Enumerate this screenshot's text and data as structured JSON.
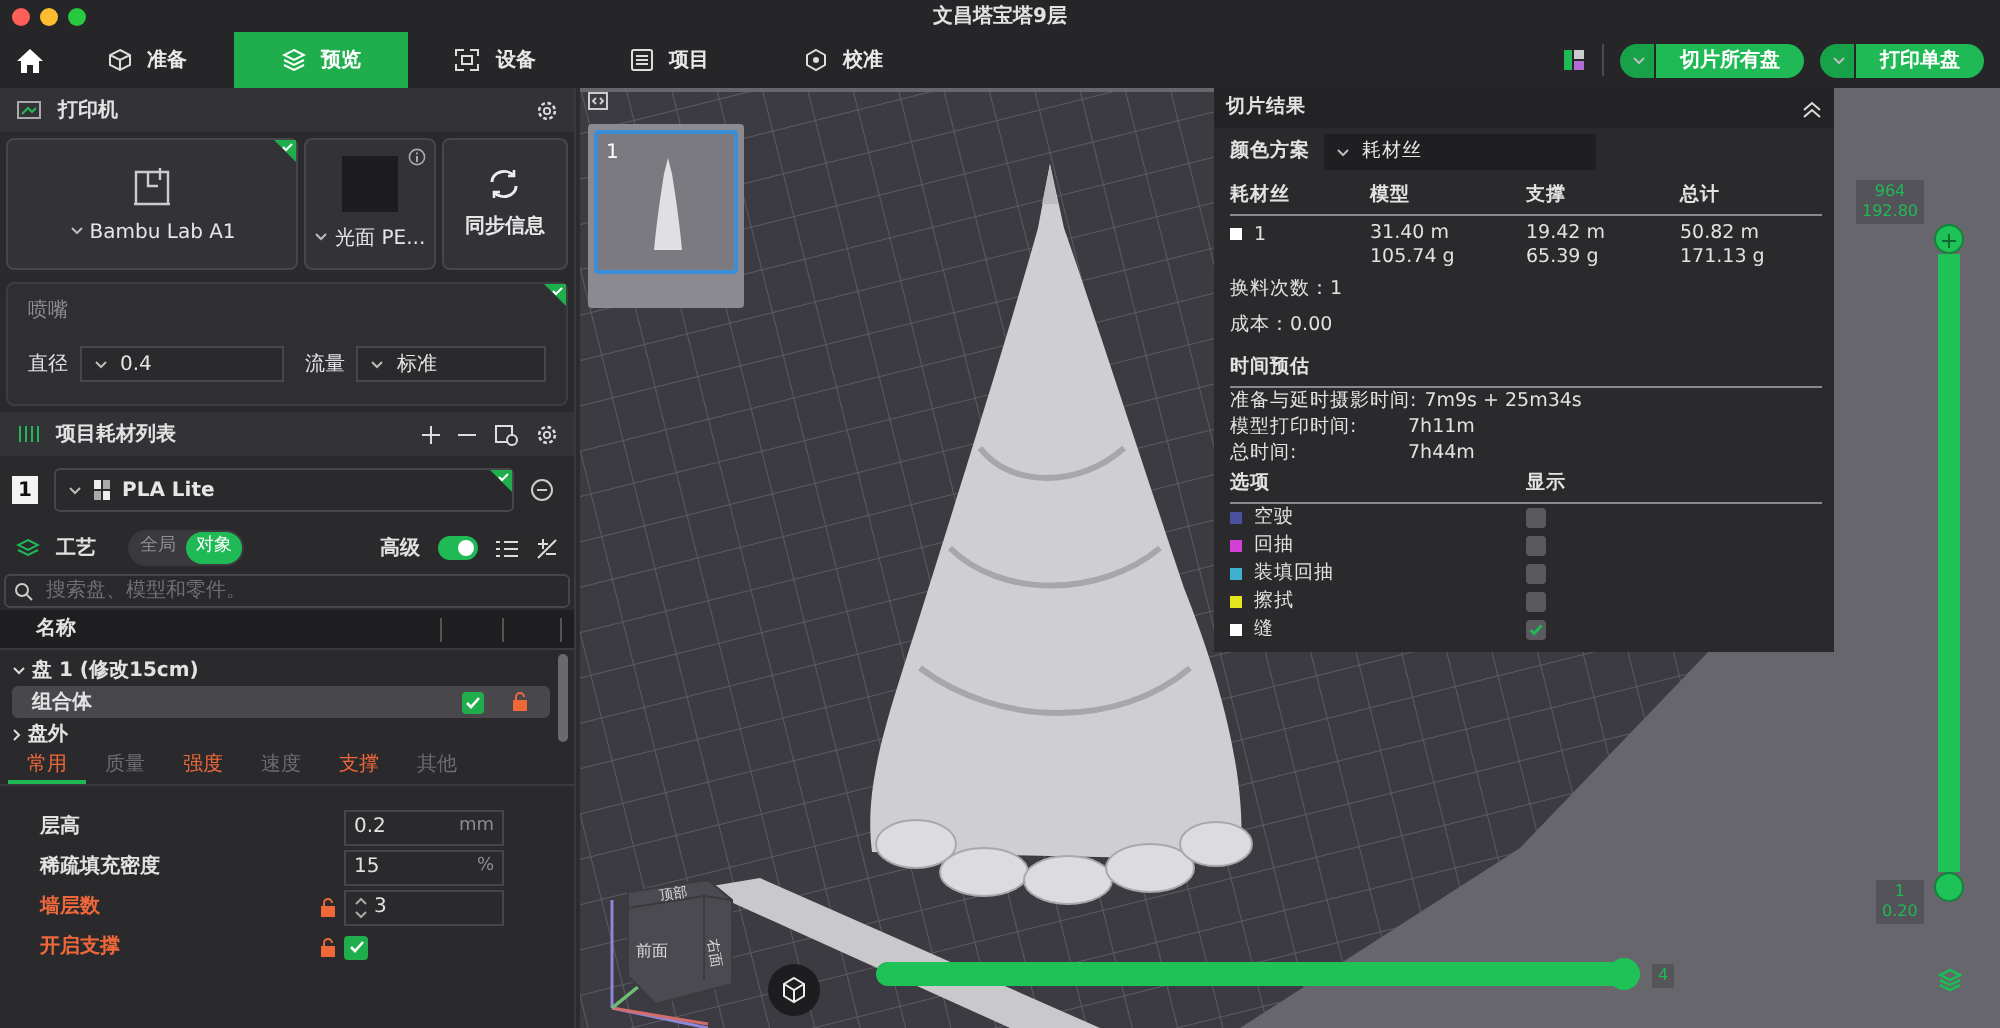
{
  "window": {
    "title": "文昌塔宝塔9层"
  },
  "tabs": [
    {
      "label": "准备",
      "selected": false
    },
    {
      "label": "预览",
      "selected": true
    },
    {
      "label": "设备",
      "selected": false
    },
    {
      "label": "项目",
      "selected": false
    },
    {
      "label": "校准",
      "selected": false
    }
  ],
  "actions": [
    {
      "label": "切片所有盘"
    },
    {
      "label": "打印单盘"
    }
  ],
  "printer": {
    "title": "打印机",
    "name": "Bambu Lab A1",
    "plate": "光面 PE...",
    "sync": "同步信息"
  },
  "nozzle": {
    "title": "喷嘴",
    "fields": [
      {
        "label": "直径",
        "value": "0.4"
      },
      {
        "label": "流量",
        "value": "标准"
      }
    ]
  },
  "filaments": {
    "title": "项目耗材列表",
    "items": [
      {
        "number": "1",
        "name": "PLA Lite"
      }
    ]
  },
  "process": {
    "title": "工艺",
    "scope": [
      {
        "label": "全局",
        "selected": false
      },
      {
        "label": "对象",
        "selected": true
      }
    ],
    "advanced": {
      "label": "高级",
      "on": true
    },
    "search": {
      "placeholder": "搜索盘、模型和零件。"
    },
    "tree": {
      "column": "名称",
      "items": [
        {
          "label": "盘 1 (修改15cm)",
          "expanded": true,
          "children": [
            {
              "label": "组合体",
              "selected": true,
              "checked": true
            }
          ]
        },
        {
          "label": "盘外",
          "expanded": false
        }
      ]
    },
    "tabs": [
      {
        "label": "常用",
        "selected": true,
        "modified": true
      },
      {
        "label": "质量",
        "selected": false,
        "modified": false
      },
      {
        "label": "强度",
        "selected": false,
        "modified": true
      },
      {
        "label": "速度",
        "selected": false,
        "modified": false
      },
      {
        "label": "支撑",
        "selected": false,
        "modified": true
      },
      {
        "label": "其他",
        "selected": false,
        "modified": false
      }
    ],
    "settings": [
      {
        "kind": "number",
        "label": "层高",
        "value": "0.2",
        "unit": "mm",
        "modified": false
      },
      {
        "kind": "number",
        "label": "稀疏填充密度",
        "value": "15",
        "unit": "%",
        "modified": false
      },
      {
        "kind": "spinner",
        "label": "墙层数",
        "value": "3",
        "modified": true
      },
      {
        "kind": "checkbox",
        "label": "开启支撑",
        "checked": true,
        "modified": true
      }
    ]
  },
  "plates": [
    {
      "number": "1",
      "selected": true
    }
  ],
  "slice_result": {
    "title": "切片结果",
    "color_scheme": {
      "label": "颜色方案",
      "value": "耗材丝"
    },
    "columns": [
      "耗材丝",
      "模型",
      "支撑",
      "总计"
    ],
    "rows": [
      {
        "filament": "1",
        "color": "#ffffff",
        "model": [
          "31.40 m",
          "105.74 g"
        ],
        "support": [
          "19.42 m",
          "65.39 g"
        ],
        "total": [
          "50.82 m",
          "171.13 g"
        ]
      }
    ],
    "summary": [
      "换料次数：1",
      "成本：0.00"
    ],
    "time_title": "时间预估",
    "times": [
      {
        "label": "准备与延时摄影时间:",
        "value": "7m9s + 25m34s"
      },
      {
        "label": "模型打印时间:",
        "value": "7h11m"
      },
      {
        "label": "总时间:",
        "value": "7h44m"
      }
    ],
    "option_columns": [
      "选项",
      "显示"
    ],
    "options": [
      {
        "label": "空驶",
        "color": "#4a4fa0",
        "shown": false
      },
      {
        "label": "回抽",
        "color": "#d23fd4",
        "shown": false
      },
      {
        "label": "装填回抽",
        "color": "#3fb0d0",
        "shown": false
      },
      {
        "label": "擦拭",
        "color": "#e6e61c",
        "shown": false
      },
      {
        "label": "缝",
        "color": "#ffffff",
        "shown": true
      }
    ]
  },
  "layer_slider": {
    "level": 1,
    "top_label": [
      "964",
      "192.80"
    ],
    "bottom_label": [
      "1",
      "0.20"
    ]
  },
  "move_slider": {
    "level": 1,
    "label": "4"
  },
  "view_cube": {
    "labels": [
      "顶部",
      "前面",
      "右面"
    ]
  }
}
